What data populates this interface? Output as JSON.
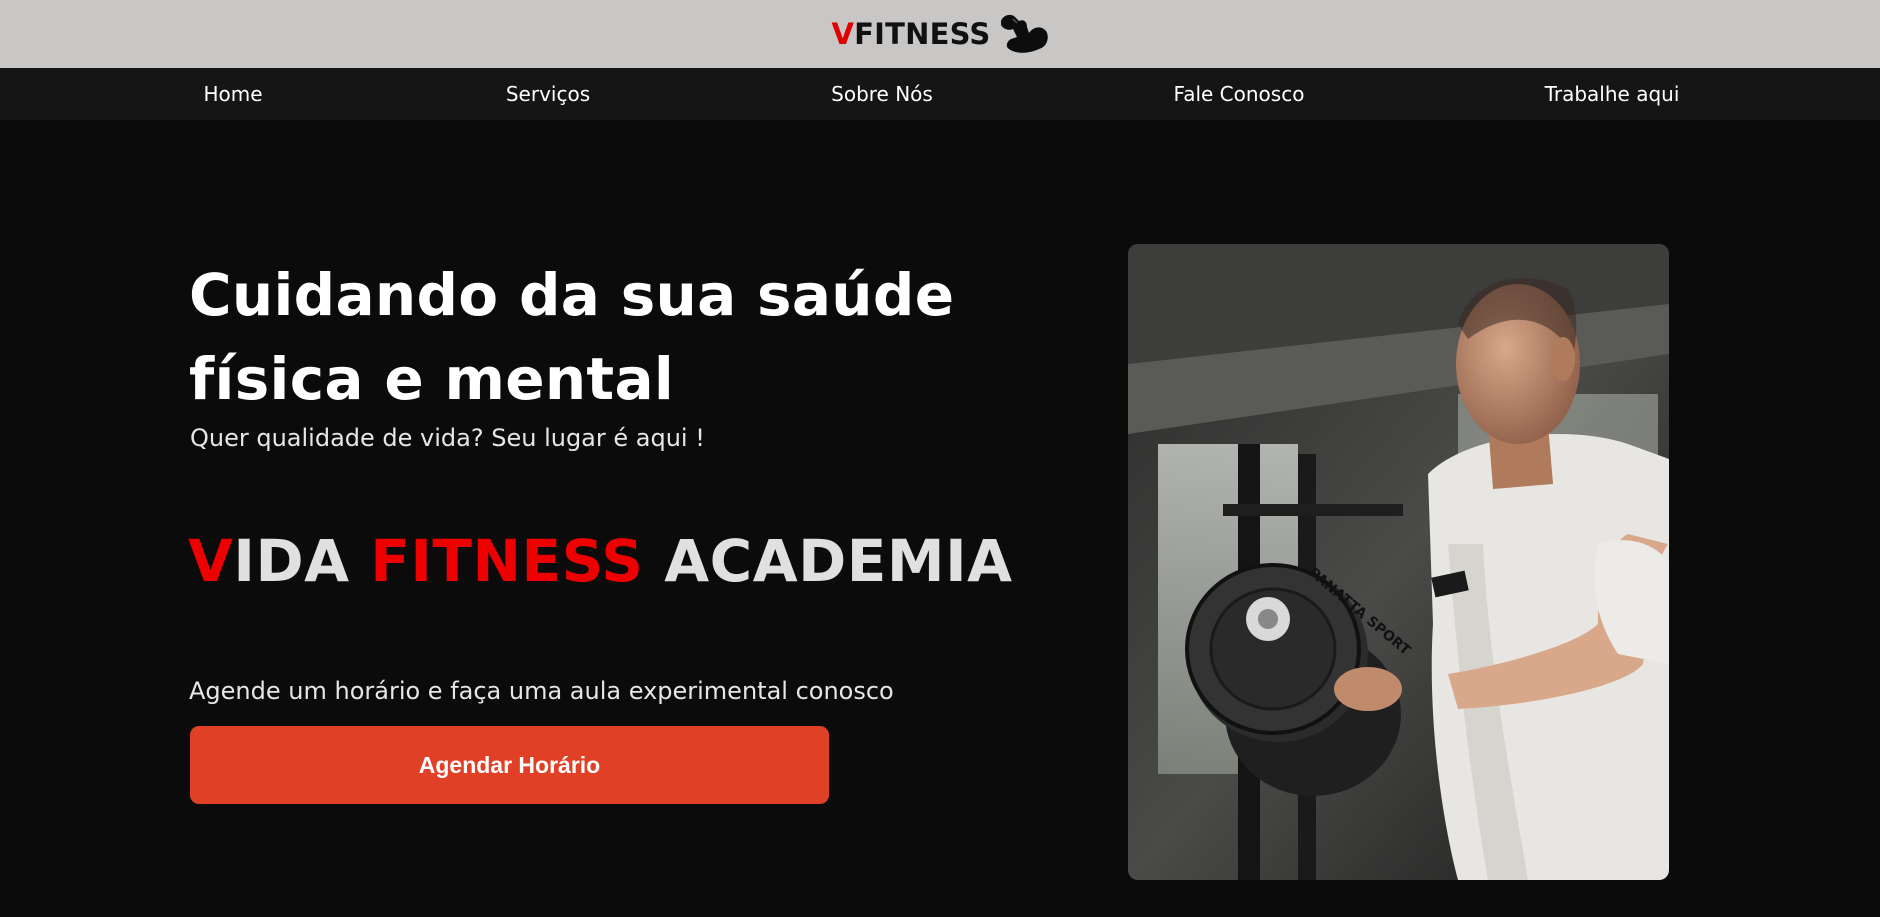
{
  "header": {
    "logo_prefix": "V",
    "logo_suffix": "FITNESS",
    "logo_icon": "flexed-arm-icon"
  },
  "nav": {
    "items": [
      {
        "label": "Home"
      },
      {
        "label": "Serviços"
      },
      {
        "label": "Sobre Nós"
      },
      {
        "label": "Fale Conosco"
      },
      {
        "label": "Trabalhe aqui"
      }
    ]
  },
  "hero": {
    "headline": "Cuidando da sua saúde física e mental",
    "subheadline": "Quer qualidade de vida? Seu lugar é aqui !",
    "brand": {
      "part1_red": "V",
      "part2": "IDA ",
      "part3_red": "FITNESS",
      "part4": " ACADEMIA"
    },
    "cta_text": "Agende um horário e faça uma aula experimental conosco",
    "cta_button": "Agendar Horário",
    "image_plate_text": "PANATTA SPORT",
    "image_alt_icon": "man-lifting-dumbbell-photo"
  },
  "colors": {
    "accent_red": "#ee0000",
    "button": "#e04026",
    "topbar": "#c9c6c6",
    "nav": "#151515",
    "background": "#0b0b0b"
  }
}
